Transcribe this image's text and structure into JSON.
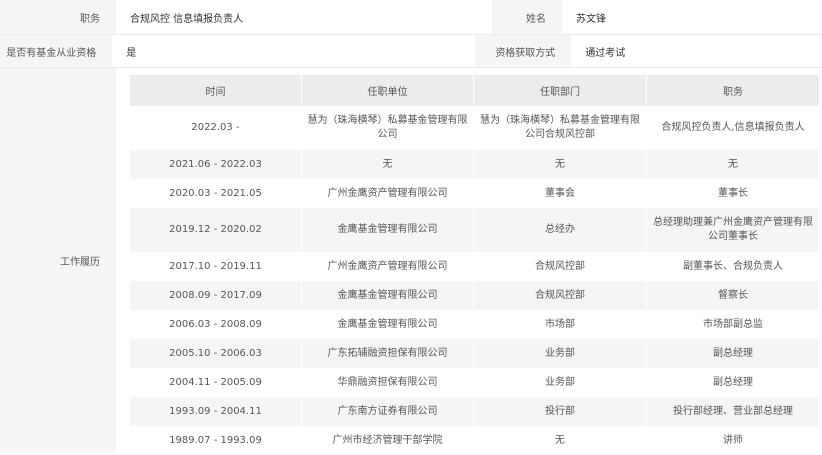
{
  "basic": {
    "position_label": "职务",
    "position_value": "合规风控 信息填报负责人",
    "name_label": "姓名",
    "name_value": "苏文锋",
    "qual_label": "是否有基金从业资格",
    "qual_value": "是",
    "method_label": "资格获取方式",
    "method_value": "通过考试"
  },
  "work_history": {
    "label": "工作履历",
    "headers": [
      "时间",
      "任职单位",
      "任职部门",
      "职务"
    ],
    "rows": [
      {
        "time": "2022.03 -",
        "company": "慧为（珠海横琴）私募基金管理有限公司",
        "dept": "慧为（珠海横琴）私募基金管理有限公司合规风控部",
        "title": "合规风控负责人,信息填报负责人"
      },
      {
        "time": "2021.06 - 2022.03",
        "company": "无",
        "dept": "无",
        "title": "无"
      },
      {
        "time": "2020.03 - 2021.05",
        "company": "广州金鹰资产管理有限公司",
        "dept": "董事会",
        "title": "董事长"
      },
      {
        "time": "2019.12 - 2020.02",
        "company": "金鹰基金管理有限公司",
        "dept": "总经办",
        "title": "总经理助理兼广州金鹰资产管理有限公司董事长"
      },
      {
        "time": "2017.10 - 2019.11",
        "company": "广州金鹰资产管理有限公司",
        "dept": "合规风控部",
        "title": "副董事长、合规负责人"
      },
      {
        "time": "2008.09 - 2017.09",
        "company": "金鹰基金管理有限公司",
        "dept": "合规风控部",
        "title": "督察长"
      },
      {
        "time": "2006.03 - 2008.09",
        "company": "金鹰基金管理有限公司",
        "dept": "市场部",
        "title": "市场部副总监"
      },
      {
        "time": "2005.10 - 2006.03",
        "company": "广东拓辅融资担保有限公司",
        "dept": "业务部",
        "title": "副总经理"
      },
      {
        "time": "2004.11 - 2005.09",
        "company": "华鼎融资担保有限公司",
        "dept": "业务部",
        "title": "副总经理"
      },
      {
        "time": "1993.09 - 2004.11",
        "company": "广东南方证券有限公司",
        "dept": "投行部",
        "title": "投行部经理、营业部总经理"
      },
      {
        "time": "1989.07 - 1993.09",
        "company": "广州市经济管理干部学院",
        "dept": "无",
        "title": "讲师"
      }
    ]
  }
}
